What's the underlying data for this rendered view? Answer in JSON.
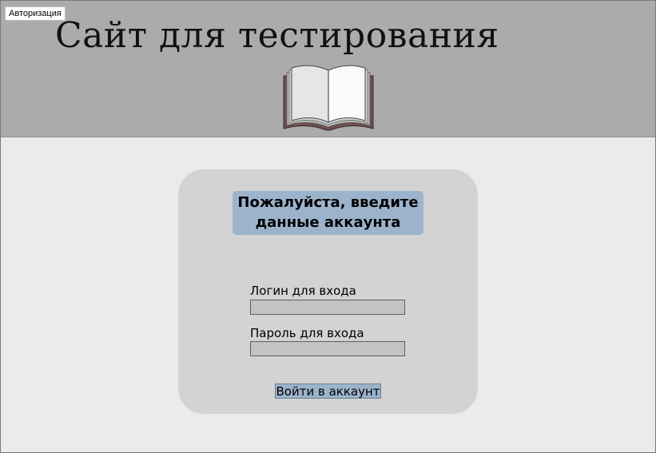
{
  "window": {
    "title": "Авторизация"
  },
  "header": {
    "site_title": "Сайт для тестирования",
    "logo_icon": "open-book-icon",
    "background_color": "#ababab"
  },
  "login_form": {
    "heading_line1": "Пожалуйста, введите",
    "heading_line2": "данные аккаунта",
    "login": {
      "label": "Логин для входа",
      "value": ""
    },
    "password": {
      "label": "Пароль для входа",
      "value": ""
    },
    "submit_label": "Войти в аккаунт",
    "accent_color": "#9cb3cc",
    "card_color": "#d3d3d3"
  }
}
